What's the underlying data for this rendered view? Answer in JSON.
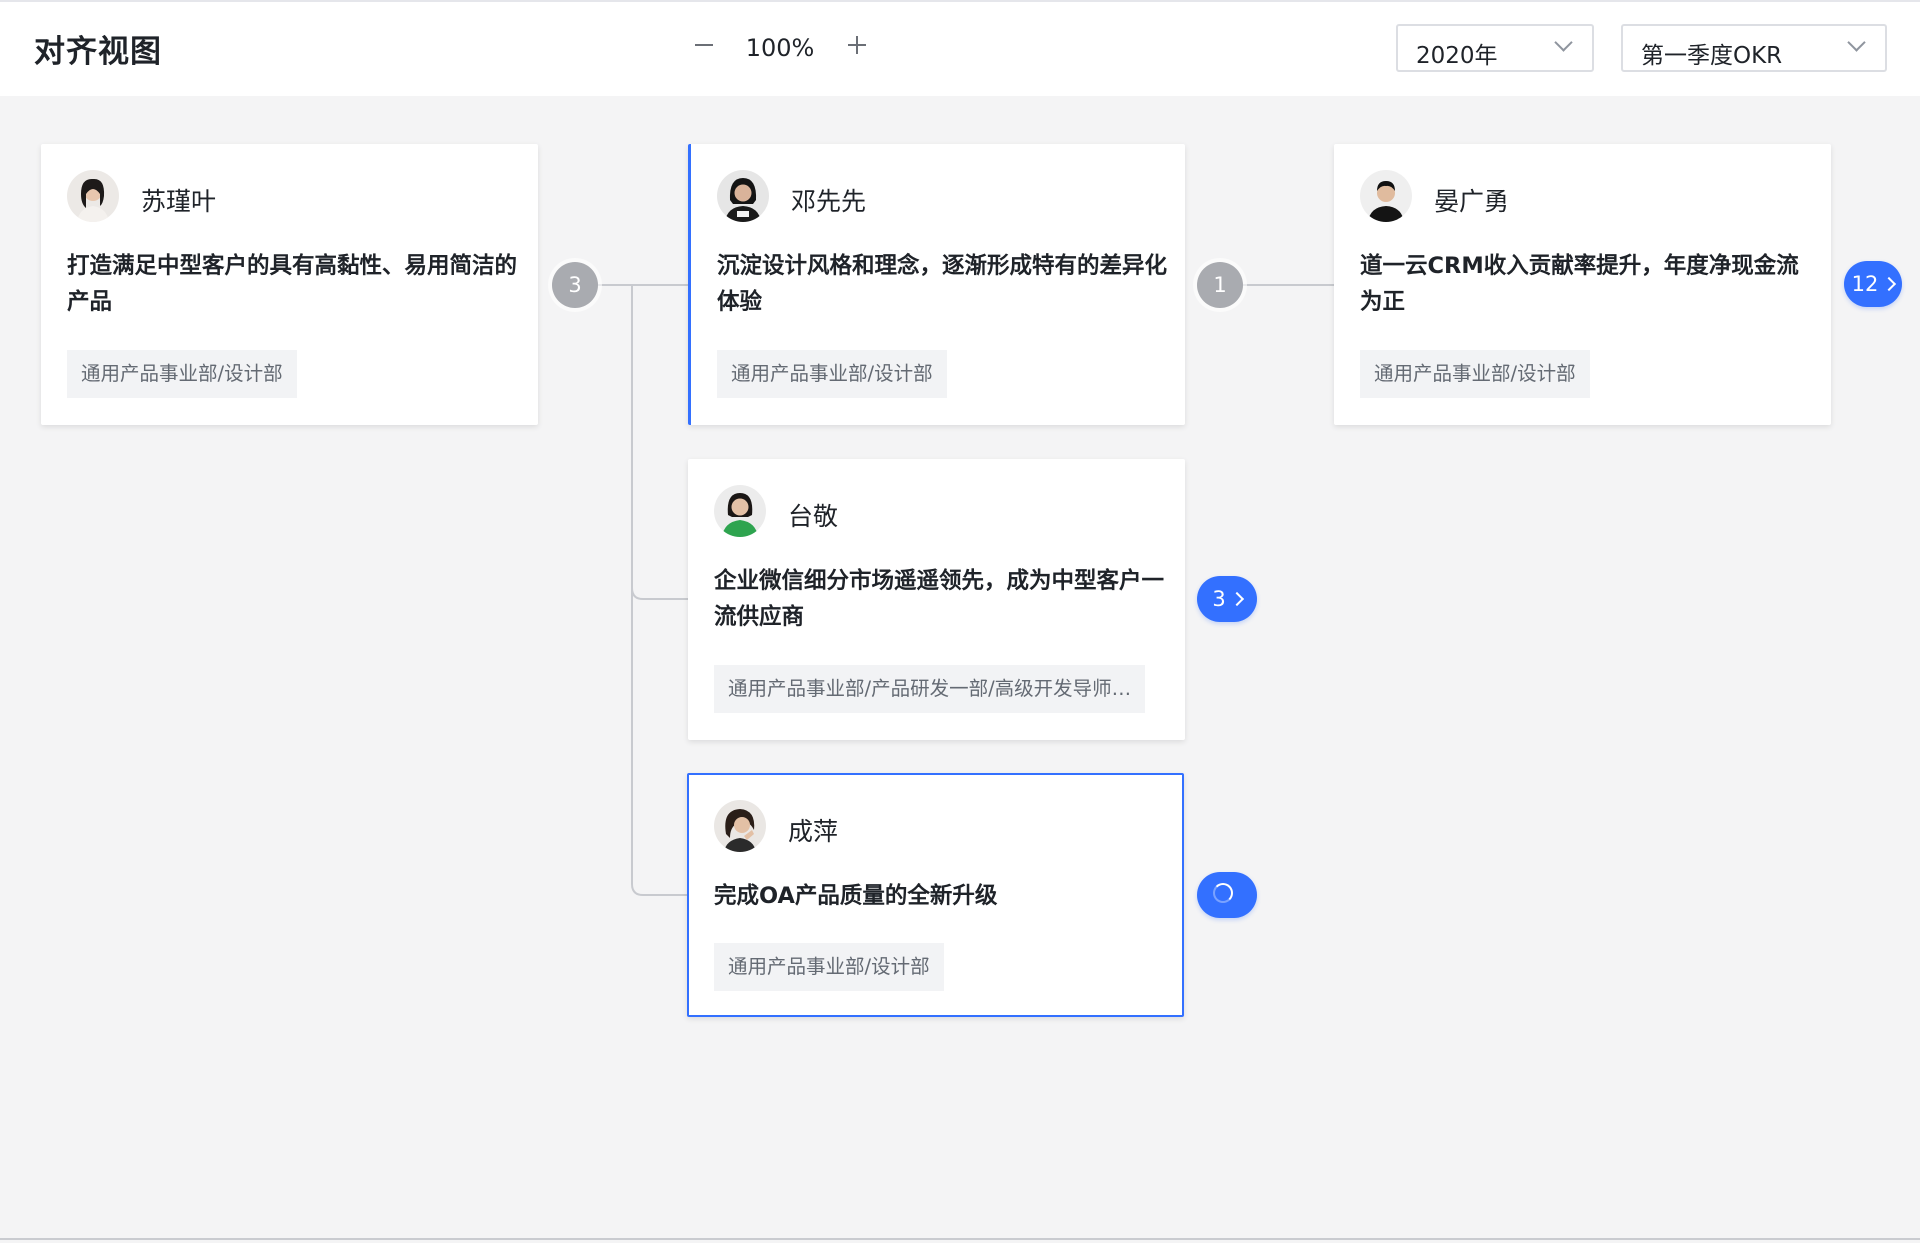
{
  "header": {
    "title": "对齐视图",
    "zoom": "100%",
    "year": "2020年",
    "period": "第一季度OKR"
  },
  "cards": [
    {
      "name": "苏瑾叶",
      "objective": "打造满足中型客户的具有高黏性、易用简洁的产品",
      "dept": "通用产品事业部/设计部",
      "child_count": "3"
    },
    {
      "name": "邓先先",
      "objective": "沉淀设计风格和理念，逐渐形成特有的差异化体验",
      "dept": "通用产品事业部/设计部",
      "child_count": "1"
    },
    {
      "name": "晏广勇",
      "objective": "道一云CRM收入贡献率提升，年度净现金流为正",
      "dept": "通用产品事业部/设计部",
      "expand_count": "12"
    },
    {
      "name": "台敬",
      "objective": "企业微信细分市场遥遥领先，成为中型客户一流供应商",
      "dept": "通用产品事业部/产品研发一部/高级开发导师…",
      "expand_count": "3"
    },
    {
      "name": "成萍",
      "objective": "完成OA产品质量的全新升级",
      "dept": "通用产品事业部/设计部",
      "state": "loading"
    }
  ],
  "colors": {
    "accent": "#3370ff",
    "badge_gray": "#a9abb0",
    "background": "#f4f4f5"
  }
}
